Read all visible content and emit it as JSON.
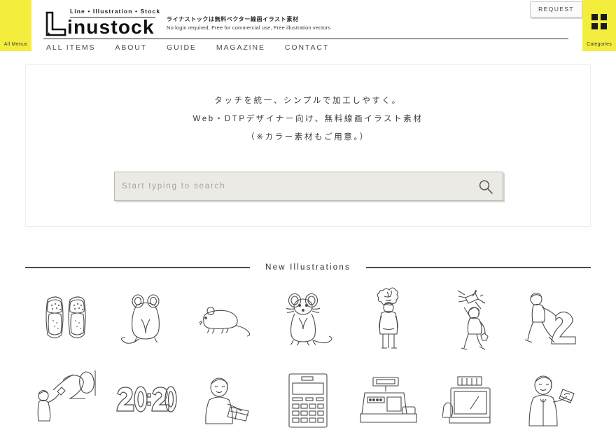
{
  "header": {
    "all_menus_label": "All Menus",
    "menu_icon": "hamburger-icon",
    "logo": {
      "tagline": "Line • Illustration • Stock",
      "wordmark": "inustock",
      "mark_icon": "l-monogram-icon"
    },
    "tagline_jp": "ライナストックは無料ベクター線画イラスト素材",
    "tagline_en": "No login required, Free for commercial use, Free illustration vectors",
    "request_label": "REQUEST",
    "categories_label": "Categories",
    "categories_icon": "grid-2x2-icon",
    "nav": [
      {
        "label": "ALL ITEMS"
      },
      {
        "label": "ABOUT"
      },
      {
        "label": "GUIDE"
      },
      {
        "label": "MAGAZINE"
      },
      {
        "label": "CONTACT"
      }
    ]
  },
  "hero": {
    "lines": [
      "タッチを統一、シンプルで加工しやすく。",
      "Web・DTPデザイナー向け、無料線画イラスト素材",
      "（※カラー素材もご用意。）"
    ],
    "search": {
      "placeholder": "Start typing to search",
      "value": "",
      "icon": "search-icon"
    }
  },
  "new_illustrations": {
    "title": "New Illustrations",
    "items": [
      {
        "name": "sandals-pair"
      },
      {
        "name": "mouse-back-view"
      },
      {
        "name": "mouse-side-view"
      },
      {
        "name": "mouse-front-view"
      },
      {
        "name": "person-holding-bouquet"
      },
      {
        "name": "person-spraying-confetti"
      },
      {
        "name": "person-pushing-number-two"
      },
      {
        "name": "person-with-numbers-201"
      },
      {
        "name": "number-2020-glasses"
      },
      {
        "name": "person-carrying-box"
      },
      {
        "name": "calculator"
      },
      {
        "name": "cash-register"
      },
      {
        "name": "desktop-monitor"
      },
      {
        "name": "person-holding-card"
      }
    ]
  },
  "colors": {
    "accent_yellow": "#f3ed3d",
    "ink": "#1a1a1a",
    "text": "#3a3a3a",
    "search_bg": "#eceae5",
    "panel_border": "#ececec"
  }
}
